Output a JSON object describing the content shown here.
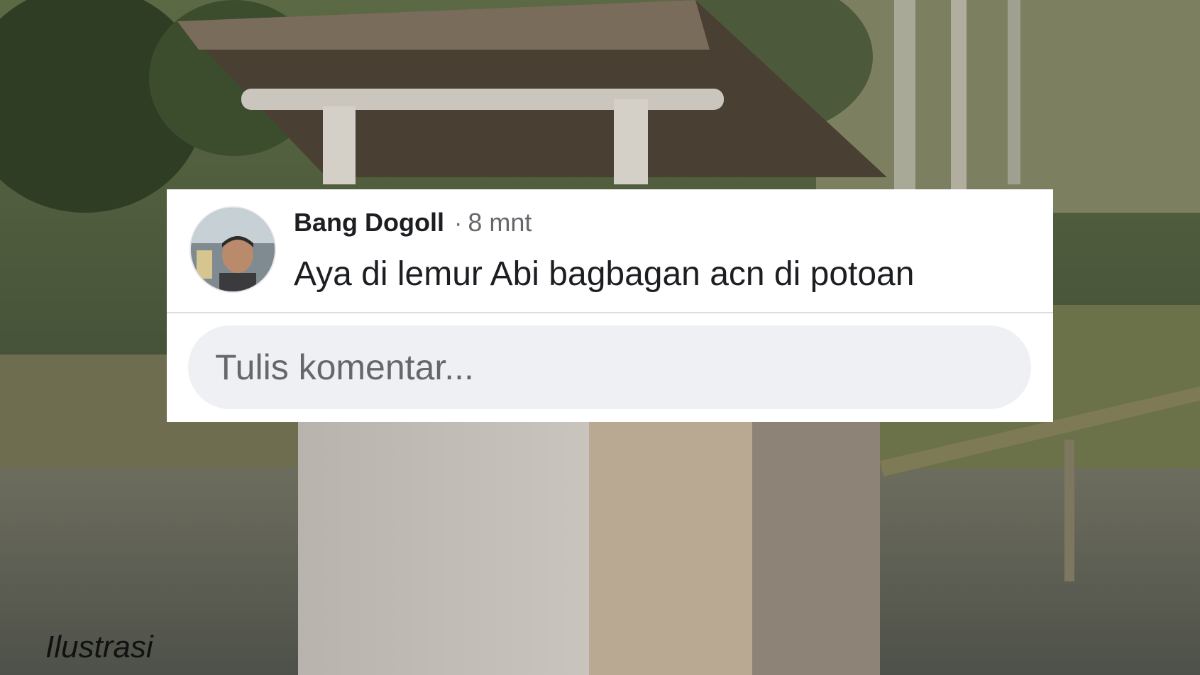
{
  "post": {
    "author": "Bang Dogoll",
    "separator": "·",
    "time": "8 mnt",
    "text": "Aya di lemur Abi bagbagan acn di potoan"
  },
  "reply": {
    "placeholder": "Tulis komentar..."
  },
  "caption": "Ilustrasi",
  "colors": {
    "card_bg": "#ffffff",
    "input_bg": "#eef0f3",
    "text_primary": "#1c1e21",
    "text_secondary": "#65676b"
  }
}
